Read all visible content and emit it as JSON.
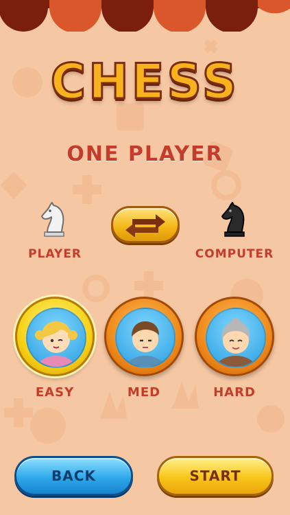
{
  "title": "CHESS",
  "mode": "ONE PLAYER",
  "sides": {
    "player_label": "PLAYER",
    "computer_label": "COMPUTER",
    "player_piece": "white-knight-icon",
    "computer_piece": "black-knight-icon"
  },
  "levels": [
    {
      "label": "EASY",
      "avatar": "girl-avatar",
      "selected": true
    },
    {
      "label": "MED",
      "avatar": "man-avatar",
      "selected": false
    },
    {
      "label": "HARD",
      "avatar": "grandma-avatar",
      "selected": false
    }
  ],
  "buttons": {
    "back": "BACK",
    "start": "START"
  },
  "colors": {
    "background": "#f6c7a3",
    "accent_red": "#c43c2a",
    "awning": "#d9572a",
    "title_yellow": "#f7b21e"
  }
}
